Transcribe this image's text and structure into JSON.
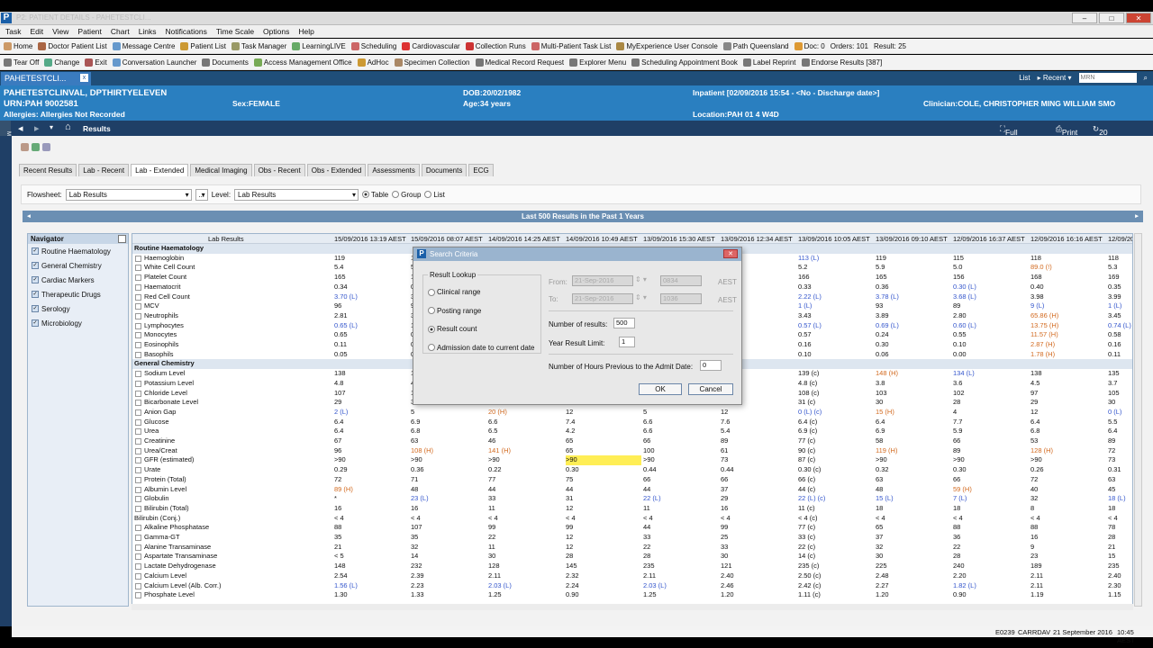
{
  "window": {
    "title": "P2: PATIENT DETAILS - PAHETESTCLI...",
    "min": "–",
    "max": "□",
    "close": "✕"
  },
  "menu": [
    "Task",
    "Edit",
    "View",
    "Patient",
    "Chart",
    "Links",
    "Notifications",
    "Time Scale",
    "Options",
    "Help"
  ],
  "toolbar1": [
    {
      "label": "Home",
      "color": "#c96"
    },
    {
      "label": "Doctor Patient List",
      "color": "#a64"
    },
    {
      "label": "Message Centre",
      "color": "#69c"
    },
    {
      "label": "Patient List",
      "color": "#c93"
    },
    {
      "label": "Task Manager",
      "color": "#996"
    },
    {
      "label": "LearningLIVE",
      "color": "#6a6"
    },
    {
      "label": "Scheduling",
      "color": "#c66"
    },
    {
      "label": "Cardiovascular",
      "color": "#d33"
    },
    {
      "label": "Collection Runs",
      "color": "#c33"
    },
    {
      "label": "Multi-Patient Task List",
      "color": "#c66"
    },
    {
      "label": "MyExperience User Console",
      "color": "#a84"
    },
    {
      "label": "Path Queensland",
      "color": "#888"
    },
    {
      "label": "Doc: 0",
      "color": "#d93"
    },
    {
      "label": "Orders: 101",
      "color": ""
    },
    {
      "label": "Result: 25",
      "color": ""
    }
  ],
  "toolbar2": [
    {
      "label": "Tear Off",
      "color": "#777"
    },
    {
      "label": "Change",
      "color": "#5a8"
    },
    {
      "label": "Exit",
      "color": "#a55"
    },
    {
      "label": "Conversation Launcher",
      "color": "#69c"
    },
    {
      "label": "Documents",
      "color": "#777"
    },
    {
      "label": "Access Management Office",
      "color": "#7a5"
    },
    {
      "label": "AdHoc",
      "color": "#c93"
    },
    {
      "label": "Specimen Collection",
      "color": "#a86"
    },
    {
      "label": "Medical Record Request",
      "color": "#777"
    },
    {
      "label": "Explorer Menu",
      "color": "#777"
    },
    {
      "label": "Scheduling Appointment Book",
      "color": "#777"
    },
    {
      "label": "Label Reprint",
      "color": "#777"
    },
    {
      "label": "Endorse Results [387]",
      "color": "#777"
    }
  ],
  "patient_tab": {
    "label": "PAHETESTCLI...",
    "close": "x"
  },
  "tab_right": {
    "list": "List",
    "recent": "Recent",
    "mrn_placeholder": "MRN"
  },
  "banner": {
    "name": "PAHETESTCLINVAL, DPTHIRTYELEVEN",
    "urn": "URN:PAH 9002581",
    "allergies": "Allergies: Allergies Not Recorded",
    "sex": "Sex:FEMALE",
    "dob": "DOB:20/02/1982",
    "age": "Age:34 years",
    "inpatient": "Inpatient [02/09/2016 15:54 - <No - Discharge date>]",
    "location": "Location:PAH 01 4 W4D",
    "clinician": "Clinician:COLE, CHRISTOPHER MING WILLIAM SMO"
  },
  "nav": {
    "title": "Results",
    "fullscreen": "Full screen",
    "print": "Print",
    "refresh": "20 minutes ago",
    "menu": "Menu"
  },
  "subtabs": [
    "Recent Results",
    "Lab - Recent",
    "Lab - Extended",
    "Medical Imaging",
    "Obs - Recent",
    "Obs - Extended",
    "Assessments",
    "Documents",
    "ECG"
  ],
  "filter": {
    "flowsheet_label": "Flowsheet:",
    "flowsheet": "Lab Results",
    "more": "...",
    "level_label": "Level:",
    "level": "Lab Results",
    "table": "Table",
    "group": "Group",
    "list": "List"
  },
  "lastbar": "Last 500 Results in the Past  1 Years",
  "navigator": {
    "title": "Navigator",
    "items": [
      "Routine Haematology",
      "General Chemistry",
      "Cardiac Markers",
      "Therapeutic Drugs",
      "Serology",
      "Microbiology"
    ]
  },
  "grid": {
    "label_header": "Lab Results",
    "dates": [
      "15/09/2016 13:19 AEST",
      "15/09/2016 08:07 AEST",
      "14/09/2016 14:25 AEST",
      "14/09/2016 10:49 AEST",
      "13/09/2016 15:30 AEST",
      "13/09/2016 12:34 AEST",
      "13/09/2016 10:05 AEST",
      "13/09/2016 09:10 AEST",
      "12/09/2016 16:37 AEST",
      "12/09/2016 16:16 AEST",
      "12/09/20"
    ],
    "rows": [
      {
        "section": true,
        "label": "Routine Haematology"
      },
      {
        "label": "Haemoglobin",
        "v": [
          "119",
          "117",
          "",
          "",
          "",
          "",
          "113 (L)",
          "119",
          "115",
          "118",
          "118"
        ]
      },
      {
        "label": "White Cell Count",
        "v": [
          "5.4",
          "5.2",
          "",
          "",
          "",
          "",
          "5.2",
          "5.9",
          "5.0",
          "89.0 (!)",
          "5.3"
        ]
      },
      {
        "label": "Platelet Count",
        "v": [
          "165",
          "168",
          "",
          "",
          "",
          "",
          "166",
          "165",
          "156",
          "168",
          "169"
        ]
      },
      {
        "label": "Haematocrit",
        "v": [
          "0.34",
          "0.37",
          "",
          "",
          "",
          "",
          "0.33",
          "0.36",
          "0.30 (L)",
          "0.40",
          "0.35"
        ]
      },
      {
        "label": "Red Cell Count",
        "v": [
          "3.70 (L)",
          "3.98",
          "",
          "",
          "",
          "",
          "2.22 (L)",
          "3.78 (L)",
          "3.68 (L)",
          "3.98",
          "3.99"
        ]
      },
      {
        "label": "MCV",
        "v": [
          "96",
          "96",
          "",
          "",
          "",
          "",
          "1 (L)",
          "93",
          "89",
          "9 (L)",
          "1 (L)"
        ]
      },
      {
        "label": "Neutrophils",
        "v": [
          "2.81",
          "3.43",
          "",
          "",
          "",
          "",
          "3.43",
          "3.89",
          "2.80",
          "65.86 (H)",
          "3.45"
        ]
      },
      {
        "label": "Lymphocytes",
        "v": [
          "0.65 (L)",
          "1.66",
          "",
          "",
          "",
          "",
          "0.57 (L)",
          "0.69 (L)",
          "0.60 (L)",
          "13.75 (H)",
          "0.74 (L)"
        ]
      },
      {
        "label": "Monocytes",
        "v": [
          "0.65",
          "0.62",
          "",
          "",
          "",
          "",
          "0.57",
          "0.24",
          "0.55",
          "11.57 (H)",
          "0.58"
        ]
      },
      {
        "label": "Eosinophils",
        "v": [
          "0.11",
          "0.21",
          "",
          "",
          "",
          "",
          "0.16",
          "0.30",
          "0.10",
          "2.87 (H)",
          "0.16"
        ]
      },
      {
        "label": "Basophils",
        "v": [
          "0.05",
          "0.05",
          "",
          "",
          "",
          "",
          "0.10",
          "0.06",
          "0.00",
          "1.78 (H)",
          "0.11"
        ]
      },
      {
        "section": true,
        "label": "General Chemistry"
      },
      {
        "label": "Sodium Level",
        "v": [
          "138",
          "143",
          "",
          "",
          "",
          "",
          "139 (c)",
          "148 (H)",
          "134 (L)",
          "138",
          "135"
        ]
      },
      {
        "label": "Potassium Level",
        "v": [
          "4.8",
          "4.9",
          "",
          "",
          "",
          "",
          "4.8 (c)",
          "3.8",
          "3.6",
          "4.5",
          "3.7"
        ]
      },
      {
        "label": "Chloride Level",
        "v": [
          "107",
          "108",
          "",
          "",
          "",
          "",
          "108 (c)",
          "103",
          "102",
          "97",
          "105"
        ]
      },
      {
        "label": "Bicarbonate Level",
        "v": [
          "29",
          "30",
          "",
          "",
          "",
          "",
          "31 (c)",
          "30",
          "28",
          "29",
          "30"
        ]
      },
      {
        "label": "Anion Gap",
        "v": [
          "2 (L)",
          "5",
          "20 (H)",
          "12",
          "5",
          "12",
          "0 (L) (c)",
          "15 (H)",
          "4",
          "12",
          "0 (L)"
        ]
      },
      {
        "label": "Glucose",
        "v": [
          "6.4",
          "6.9",
          "6.6",
          "7.4",
          "6.6",
          "7.6",
          "6.4 (c)",
          "6.4",
          "7.7",
          "6.4",
          "5.5"
        ]
      },
      {
        "label": "Urea",
        "v": [
          "6.4",
          "6.8",
          "6.5",
          "4.2",
          "6.6",
          "5.4",
          "6.9 (c)",
          "6.9",
          "5.9",
          "6.8",
          "6.4"
        ]
      },
      {
        "label": "Creatinine",
        "v": [
          "67",
          "63",
          "46",
          "65",
          "66",
          "89",
          "77 (c)",
          "58",
          "66",
          "53",
          "89"
        ]
      },
      {
        "label": "Urea/Creat",
        "v": [
          "96",
          "108 (H)",
          "141 (H)",
          "65",
          "100",
          "61",
          "90 (c)",
          "119 (H)",
          "89",
          "128 (H)",
          "72"
        ]
      },
      {
        "label": "GFR (estimated)",
        "v": [
          ">90",
          ">90",
          ">90",
          ">90",
          ">90",
          "73",
          "87 (c)",
          ">90",
          ">90",
          ">90",
          "73"
        ]
      },
      {
        "label": "Urate",
        "v": [
          "0.29",
          "0.36",
          "0.22",
          "0.30",
          "0.44",
          "0.44",
          "0.30 (c)",
          "0.32",
          "0.30",
          "0.26",
          "0.31"
        ]
      },
      {
        "label": "Protein (Total)",
        "v": [
          "72",
          "71",
          "77",
          "75",
          "66",
          "66",
          "66 (c)",
          "63",
          "66",
          "72",
          "63"
        ]
      },
      {
        "label": "Albumin Level",
        "v": [
          "89 (H)",
          "48",
          "44",
          "44",
          "44",
          "37",
          "44 (c)",
          "48",
          "59 (H)",
          "40",
          "45"
        ]
      },
      {
        "label": "Globulin",
        "v": [
          "*",
          "23 (L)",
          "33",
          "31",
          "22 (L)",
          "29",
          "22 (L) (c)",
          "15 (L)",
          "7 (L)",
          "32",
          "18 (L)"
        ]
      },
      {
        "label": "Bilirubin (Total)",
        "v": [
          "16",
          "16",
          "11",
          "12",
          "11",
          "16",
          "11 (c)",
          "18",
          "18",
          "8",
          "18"
        ]
      },
      {
        "section2": true,
        "label": "Bilirubin (Conj.)",
        "v": [
          "< 4",
          "< 4",
          "< 4",
          "< 4",
          "< 4",
          "< 4",
          "< 4 (c)",
          "< 4",
          "< 4",
          "< 4",
          "< 4"
        ]
      },
      {
        "label": "Alkaline Phosphatase",
        "v": [
          "88",
          "107",
          "99",
          "99",
          "44",
          "99",
          "77 (c)",
          "65",
          "88",
          "88",
          "78"
        ]
      },
      {
        "label": "Gamma-GT",
        "v": [
          "35",
          "35",
          "22",
          "12",
          "33",
          "25",
          "33 (c)",
          "37",
          "36",
          "16",
          "28"
        ]
      },
      {
        "label": "Alanine Transaminase",
        "v": [
          "21",
          "32",
          "11",
          "12",
          "22",
          "33",
          "22 (c)",
          "32",
          "22",
          "9",
          "21"
        ]
      },
      {
        "label": "Aspartate Transaminase",
        "v": [
          "< 5",
          "14",
          "30",
          "28",
          "28",
          "30",
          "14 (c)",
          "30",
          "28",
          "23",
          "15"
        ]
      },
      {
        "label": "Lactate Dehydrogenase",
        "v": [
          "148",
          "232",
          "128",
          "145",
          "235",
          "121",
          "235 (c)",
          "225",
          "240",
          "189",
          "235"
        ]
      },
      {
        "label": "Calcium Level",
        "v": [
          "2.54",
          "2.39",
          "2.11",
          "2.32",
          "2.11",
          "2.40",
          "2.50 (c)",
          "2.48",
          "2.20",
          "2.11",
          "2.40"
        ]
      },
      {
        "label": "Calcium Level (Alb. Corr.)",
        "v": [
          "1.56 (L)",
          "2.23",
          "2.03 (L)",
          "2.24",
          "2.03 (L)",
          "2.46",
          "2.42 (c)",
          "2.27",
          "1.82 (L)",
          "2.11",
          "2.30"
        ]
      },
      {
        "label": "Phosphate Level",
        "v": [
          "1.30",
          "1.33",
          "1.25",
          "0.90",
          "1.25",
          "1.20",
          "1.11 (c)",
          "1.20",
          "0.90",
          "1.19",
          "1.15"
        ]
      }
    ]
  },
  "dialog": {
    "title": "Search Criteria",
    "close": "✕",
    "group_label": "Result Lookup",
    "options": [
      "Clinical range",
      "Posting range",
      "Result count",
      "Admission date to current date"
    ],
    "selected": 2,
    "from_label": "From:",
    "from_date": "21-Sep-2016",
    "from_time": "0834",
    "to_label": "To:",
    "to_date": "21-Sep-2016",
    "to_time": "1036",
    "aest": "AEST",
    "num_results_label": "Number of results:",
    "num_results": "500",
    "year_limit_label": "Year Result Limit:",
    "year_limit": "1",
    "hours_label": "Number of Hours Previous to the Admit Date:",
    "hours": "0",
    "ok": "OK",
    "cancel": "Cancel"
  },
  "status": {
    "code": "E0239",
    "user": "CARRDAV",
    "date": "21 September 2016",
    "time": "10:45 AEST"
  }
}
